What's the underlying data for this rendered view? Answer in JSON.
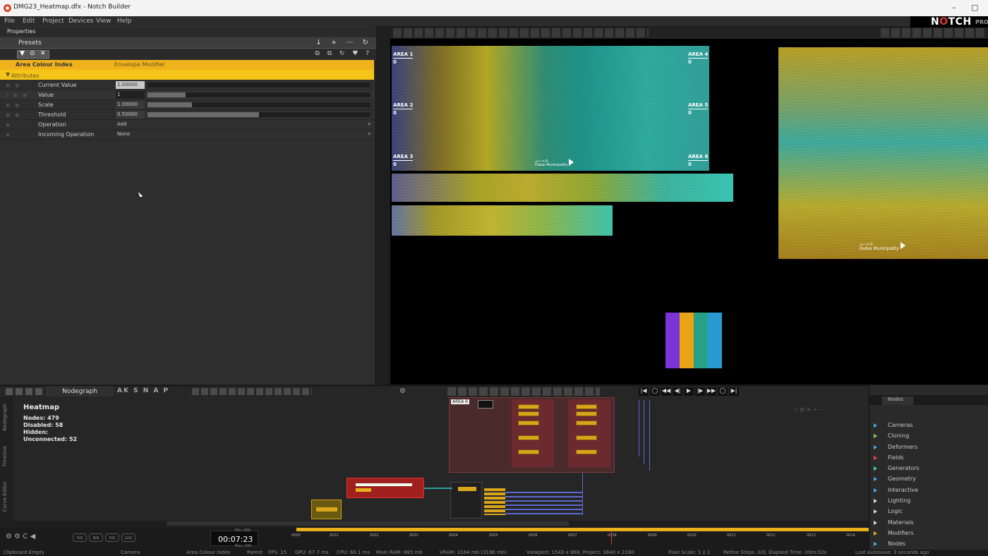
{
  "window": {
    "title": "DMG23_Heatmap.dfx - Notch Builder",
    "minimize": "–",
    "maximize": "▢"
  },
  "menu": [
    "File",
    "Edit",
    "Project",
    "Devices",
    "View",
    "Help"
  ],
  "logo": {
    "brand_pre": "N",
    "brand_o": "O",
    "brand_post": "TCH",
    "edition": "PRO"
  },
  "properties": {
    "header": "Properties",
    "presets_label": "Presets",
    "presets_buttons": "↓ + ⋯ ↻",
    "toolbar_icons": [
      "▼",
      "⊙",
      "✕"
    ],
    "toolbar_right": "⧉ ⧉ ↻ ♥ ?",
    "node_name": "Area Colour Index",
    "node_type": "Envelope Modifier",
    "attributes_label": "Attributes",
    "rows": [
      {
        "label": "Current Value",
        "value": "1.00000",
        "fill": 0.0
      },
      {
        "label": "Value",
        "value": "1",
        "fill": 0.17
      },
      {
        "label": "Scale",
        "value": "1.00000",
        "fill": 0.2
      },
      {
        "label": "Threshold",
        "value": "0.50000",
        "fill": 0.5
      }
    ],
    "dropdowns": [
      {
        "label": "Operation",
        "value": "Add"
      },
      {
        "label": "Incoming Operation",
        "value": "None"
      }
    ]
  },
  "viewport": {
    "areas": [
      {
        "name": "AREA 1",
        "value": "0"
      },
      {
        "name": "AREA 2",
        "value": "0"
      },
      {
        "name": "AREA 3",
        "value": "0"
      },
      {
        "name": "AREA 4",
        "value": "0"
      },
      {
        "name": "AREA 5",
        "value": "0"
      },
      {
        "name": "AREA 6",
        "value": "0"
      }
    ],
    "logo_text": "Dubai Municipality",
    "logo_arabic": "بلدية دبي",
    "swatch_colors": [
      "#7a34d8",
      "#e8a414",
      "#27a088",
      "#2a9ad4"
    ]
  },
  "nodegraph": {
    "tab_label": "Nodegraph",
    "snap_letters": "AK S N A P",
    "title": "Heatmap",
    "stats": [
      {
        "label": "Nodes:",
        "value": "479"
      },
      {
        "label": "Disabled:",
        "value": "58"
      },
      {
        "label": "Hidden:",
        "value": ""
      },
      {
        "label": "Unconnected:",
        "value": "52"
      }
    ],
    "group_label": "AREA 6",
    "side_tabs": [
      "Nodegraph",
      "Timeline",
      "Curve Editor"
    ],
    "transport": [
      "|◀",
      "◯",
      "◀◀",
      "◀|",
      "▶",
      "|▶",
      "▶▶",
      "◯",
      "▶|"
    ]
  },
  "nodes_panel": {
    "tab": "Nodes",
    "categories": [
      "Cameras",
      "Cloning",
      "Deformers",
      "Fields",
      "Generators",
      "Geometry",
      "Interactive",
      "Lighting",
      "Logic",
      "Materials",
      "Modifiers",
      "Nodes"
    ],
    "category_colors": [
      "#4aa8e8",
      "#8ad05a",
      "#4aa8e8",
      "#e04a4a",
      "#4ad0c0",
      "#4aa8e8",
      "#4aa8e8",
      "#d8d8d8",
      "#d8d8d8",
      "#d8d8d8",
      "#e8b01a",
      "#4aa8e8"
    ]
  },
  "timeline": {
    "time": "00:07:23",
    "min": "Min: 000",
    "max": "Max: 030",
    "buttons": [
      "RIS",
      "BIN",
      "HIS",
      "LOG"
    ],
    "ticks": [
      "0000",
      "0001",
      "0002",
      "0003",
      "0004",
      "0005",
      "0006",
      "0007",
      "0008",
      "0009",
      "0010",
      "0011",
      "0012",
      "0013",
      "0014"
    ]
  },
  "status": {
    "clipboard": "Clipboard Empty",
    "camera": "Camera",
    "node": "Area Colour Index",
    "parent": "Parent",
    "fps": "FPS: 15",
    "gpu": "GPU: 67.7 ms",
    "cpu": "CPU: 60.1 ms",
    "ram": "Main RAM: 885 mb",
    "vram": "VRAM: 3164 mb (3196 mb)",
    "viewport": "Viewport: 1543 x 868, Project: 3840 x 2160",
    "pixel": "Pixel Scale: 1 x 1",
    "refine": "Refine Steps: 0/0, Elapsed Time: 00m:02s",
    "autosave": "Last Autosave: 3 seconds ago"
  }
}
